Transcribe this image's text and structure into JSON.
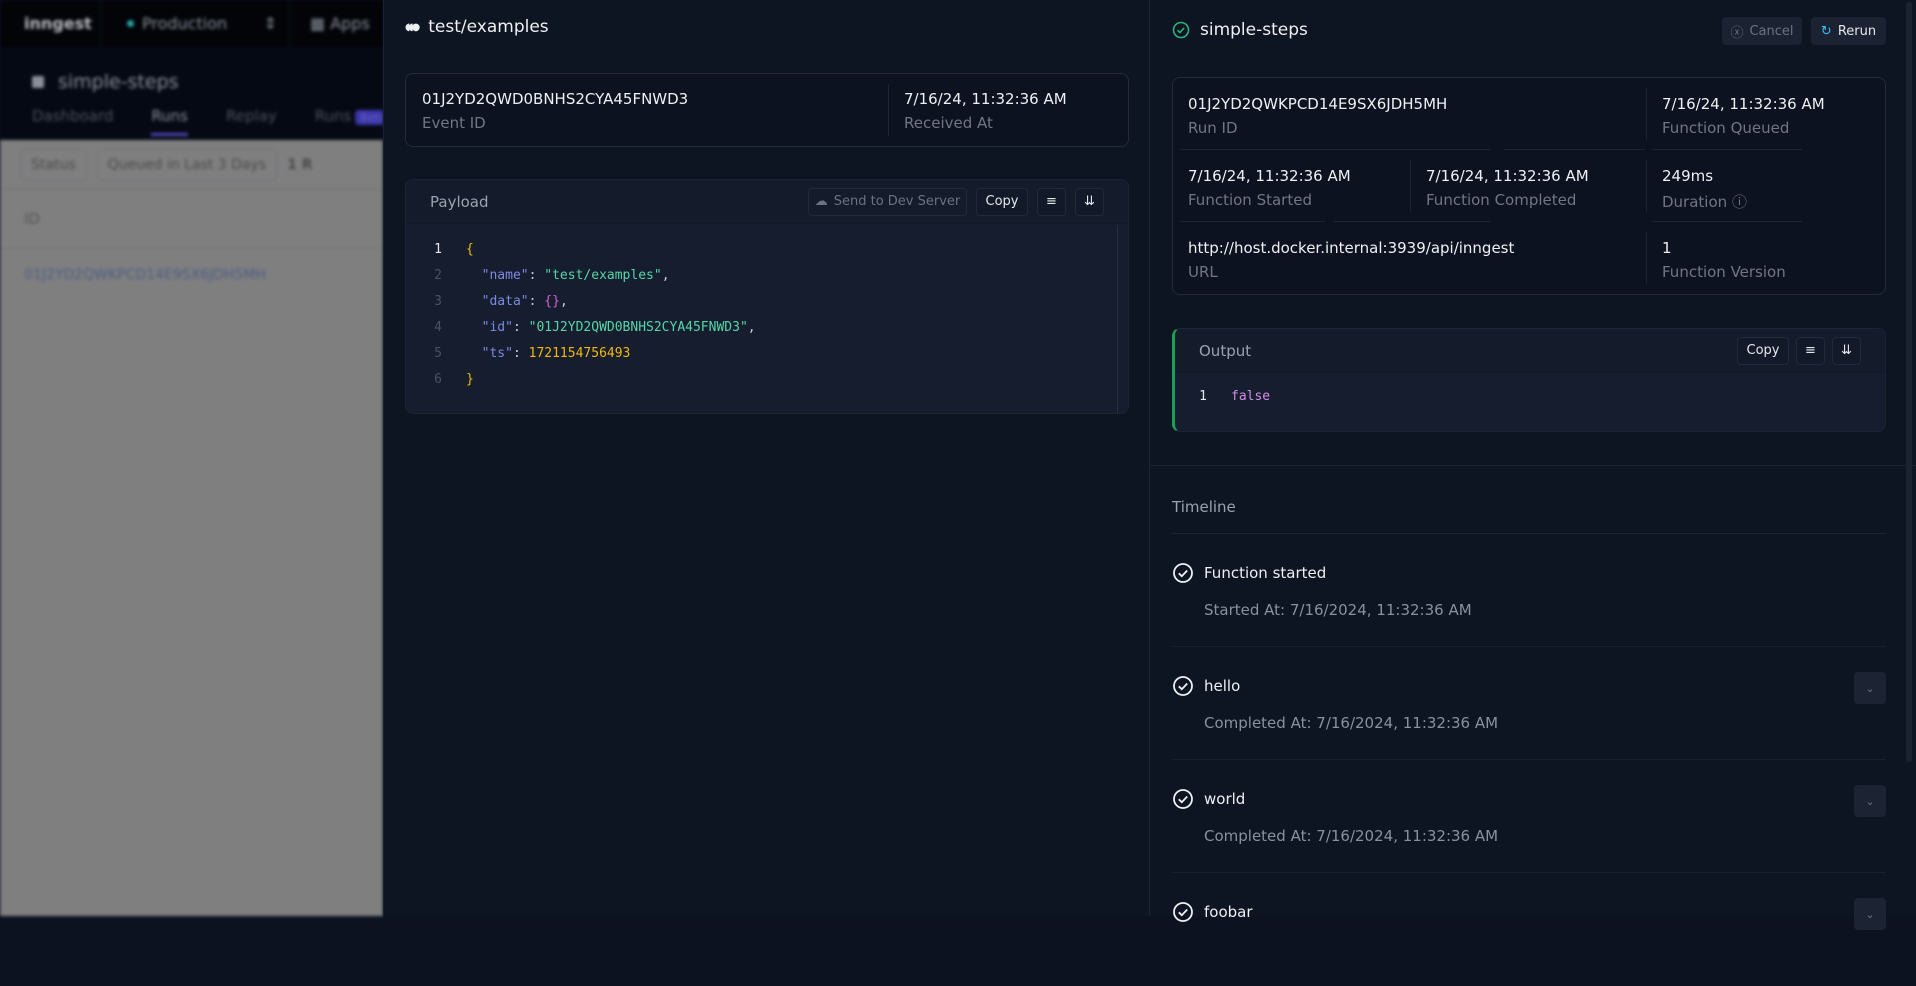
{
  "background": {
    "logo": "inngest",
    "environment": "Production",
    "apps_label": "Apps",
    "function_name": "simple-steps",
    "tabs": [
      "Dashboard",
      "Runs",
      "Replay",
      "Runs"
    ],
    "beta_badge": "Beta",
    "filters": {
      "status": "Status",
      "range": "Queued in Last 3 Days",
      "count": "1 R"
    },
    "table_header": "ID",
    "row_id": "01J2YD2QWKPCD14E9SX6JDH5MH"
  },
  "event": {
    "title": "test/examples",
    "event_id": "01J2YD2QWD0BNHS2CYA45FNWD3",
    "event_id_label": "Event ID",
    "received_at": "7/16/24, 11:32:36 AM",
    "received_at_label": "Received At",
    "payload": {
      "label": "Payload",
      "send_label": "Send to Dev Server",
      "copy_label": "Copy",
      "line_numbers": [
        "1",
        "2",
        "3",
        "4",
        "5",
        "6"
      ],
      "lines": {
        "open": "{",
        "name_key": "\"name\"",
        "name_val": "\"test/examples\"",
        "data_key": "\"data\"",
        "data_val": "{}",
        "id_key": "\"id\"",
        "id_val": "\"01J2YD2QWD0BNHS2CYA45FNWD3\"",
        "ts_key": "\"ts\"",
        "ts_val": "1721154756493",
        "close": "}"
      }
    }
  },
  "run": {
    "title": "simple-steps",
    "status": "completed",
    "cancel_label": "Cancel",
    "rerun_label": "Rerun",
    "run_id": "01J2YD2QWKPCD14E9SX6JDH5MH",
    "run_id_label": "Run ID",
    "queued": "7/16/24, 11:32:36 AM",
    "queued_label": "Function Queued",
    "started": "7/16/24, 11:32:36 AM",
    "started_label": "Function Started",
    "completed": "7/16/24, 11:32:36 AM",
    "completed_label": "Function Completed",
    "duration": "249ms",
    "duration_label": "Duration",
    "url": "http://host.docker.internal:3939/api/inngest",
    "url_label": "URL",
    "version": "1",
    "version_label": "Function Version",
    "output": {
      "label": "Output",
      "copy_label": "Copy",
      "line_number": "1",
      "value": "false"
    },
    "timeline": {
      "label": "Timeline",
      "items": [
        {
          "title": "Function started",
          "subtitle": "Started At: 7/16/2024, 11:32:36 AM"
        },
        {
          "title": "hello",
          "subtitle": "Completed At: 7/16/2024, 11:32:36 AM"
        },
        {
          "title": "world",
          "subtitle": "Completed At: 7/16/2024, 11:32:36 AM"
        },
        {
          "title": "foobar",
          "subtitle": ""
        }
      ]
    }
  },
  "colors": {
    "success": "#2fb37a",
    "accent": "#38bdf8",
    "output_bar": "#1f9d55"
  }
}
